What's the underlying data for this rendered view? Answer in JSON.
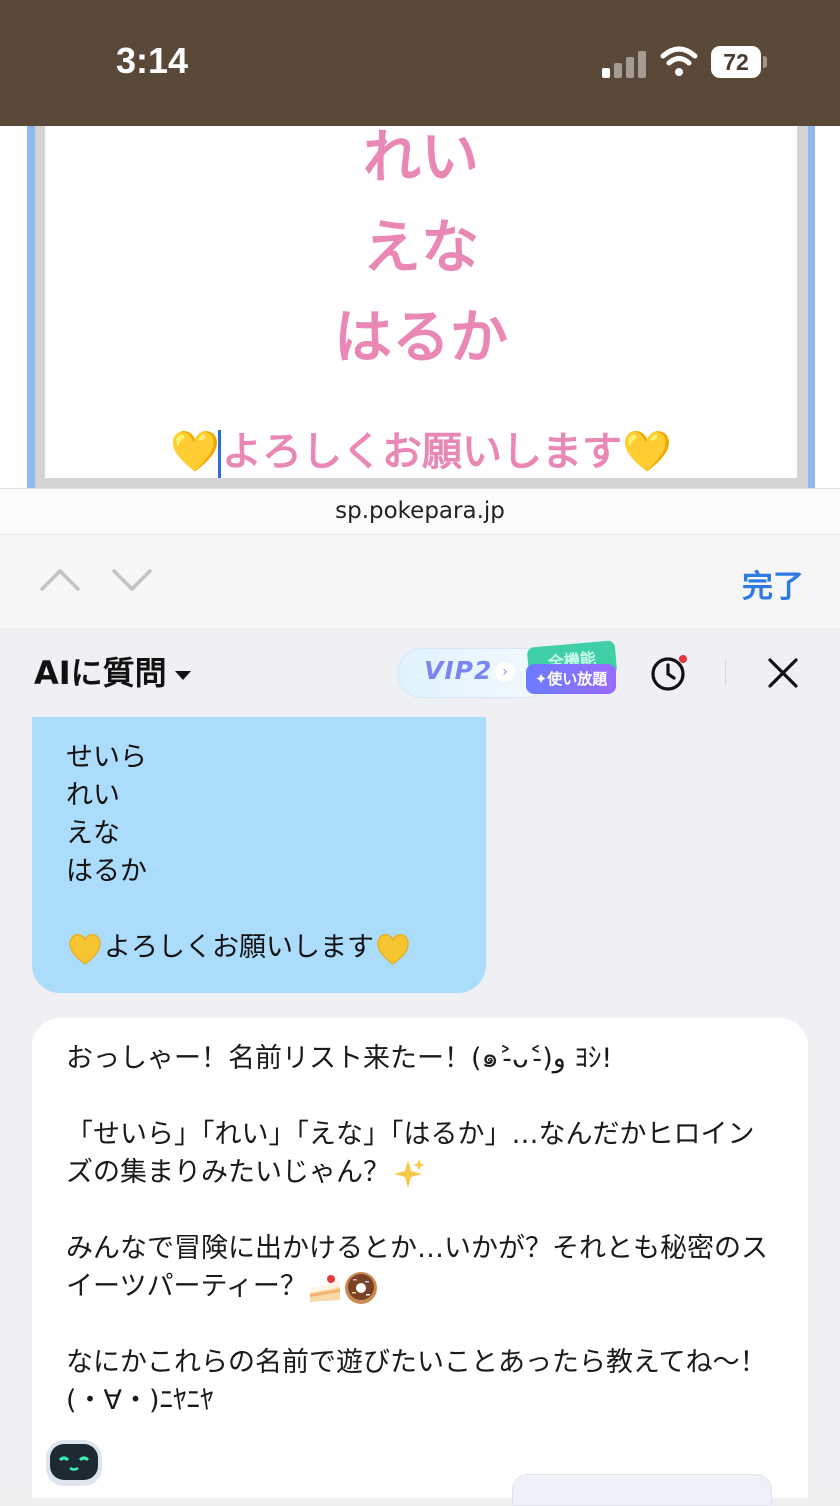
{
  "status_bar": {
    "time": "3:14",
    "battery": "72",
    "icons": [
      "signal-icon",
      "wifi-icon",
      "battery-icon"
    ]
  },
  "webview": {
    "names": [
      "れい",
      "えな",
      "はるか"
    ],
    "greeting_text": "よろしくお願いします",
    "heart_emoji": "💛"
  },
  "url_bar": {
    "domain": "sp.pokepara.jp"
  },
  "find_bar": {
    "done_label": "完了",
    "icons": [
      "chevron-up-icon",
      "chevron-down-icon"
    ]
  },
  "ai_panel": {
    "title": "AIに質問",
    "vip_label": "VIP2",
    "vip_badge_top": "全機能",
    "vip_badge_label": "✦使い放題",
    "icons": [
      "clock-icon",
      "close-icon",
      "robot-avatar-icon"
    ],
    "user_message": {
      "lines": [
        "せいら",
        "れい",
        "えな",
        "はるか"
      ],
      "greeting": "よろしくお願いします"
    },
    "ai_message": {
      "p1": "おっしゃー！名前リスト来たー！(๑˃̵ᴗ˂̵)و ﾖｼ!",
      "p2": "「せいら」「れい」「えな」「はるか」…なんだかヒロインズの集まりみたいじゃん？",
      "p3": "みんなで冒険に出かけるとか…いかが？それとも秘密のスイーツパーティー？",
      "p4": "なにかこれらの名前で遊びたいことあったら教えてね〜！(・∀・)ﾆﾔﾆﾔ"
    },
    "accent_colors": {
      "pink_text": "#e988b5",
      "user_bubble": "#abdcfb",
      "link_blue": "#2f7ae0"
    }
  }
}
